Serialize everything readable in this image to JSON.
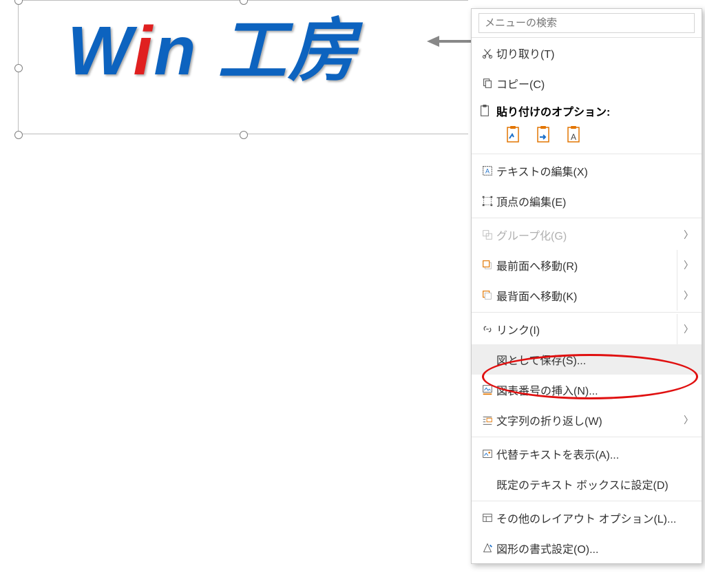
{
  "canvas": {
    "textbox_text_w": "W",
    "textbox_text_i": "i",
    "textbox_text_rest": "n 工房"
  },
  "menu": {
    "search_placeholder": "メニューの検索",
    "cut": "切り取り(T)",
    "copy": "コピー(C)",
    "paste_title": "貼り付けのオプション:",
    "edit_text": "テキストの編集(X)",
    "edit_vertex": "頂点の編集(E)",
    "group": "グループ化(G)",
    "bring_front": "最前面へ移動(R)",
    "send_back": "最背面へ移動(K)",
    "link": "リンク(I)",
    "save_as_picture": "図として保存(S)...",
    "insert_caption": "図表番号の挿入(N)...",
    "wrap_text": "文字列の折り返し(W)",
    "show_alt_text": "代替テキストを表示(A)...",
    "set_default_textbox": "既定のテキスト ボックスに設定(D)",
    "more_layout": "その他のレイアウト オプション(L)...",
    "format_shape": "図形の書式設定(O)..."
  }
}
